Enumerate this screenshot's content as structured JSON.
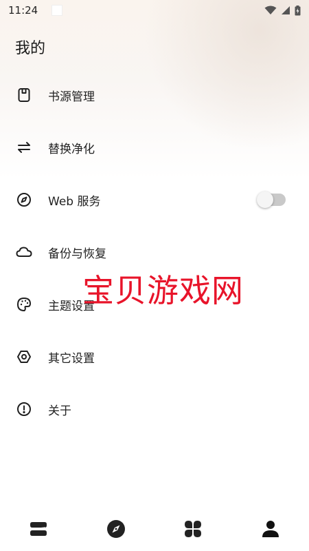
{
  "status_bar": {
    "time": "11:24"
  },
  "page": {
    "title": "我的"
  },
  "menu": {
    "items": [
      {
        "label": "书源管理",
        "icon": "book-source-icon"
      },
      {
        "label": "替换净化",
        "icon": "swap-arrows-icon"
      },
      {
        "label": "Web 服务",
        "icon": "compass-icon",
        "toggle": false
      },
      {
        "label": "备份与恢复",
        "icon": "cloud-icon"
      },
      {
        "label": "主题设置",
        "icon": "palette-icon"
      },
      {
        "label": "其它设置",
        "icon": "settings-hex-icon"
      },
      {
        "label": "关于",
        "icon": "info-exclamation-icon"
      }
    ]
  },
  "watermark": {
    "text": "宝贝游戏网"
  },
  "bottom_nav": {
    "items": [
      {
        "icon": "bookshelf-icon",
        "active": false
      },
      {
        "icon": "compass-nav-icon",
        "active": false
      },
      {
        "icon": "grid-clover-icon",
        "active": false
      },
      {
        "icon": "person-icon",
        "active": true
      }
    ]
  },
  "colors": {
    "watermark": "#e8142a",
    "toggle_track": "#c9c9c9",
    "icon": "#1f1f1f"
  }
}
